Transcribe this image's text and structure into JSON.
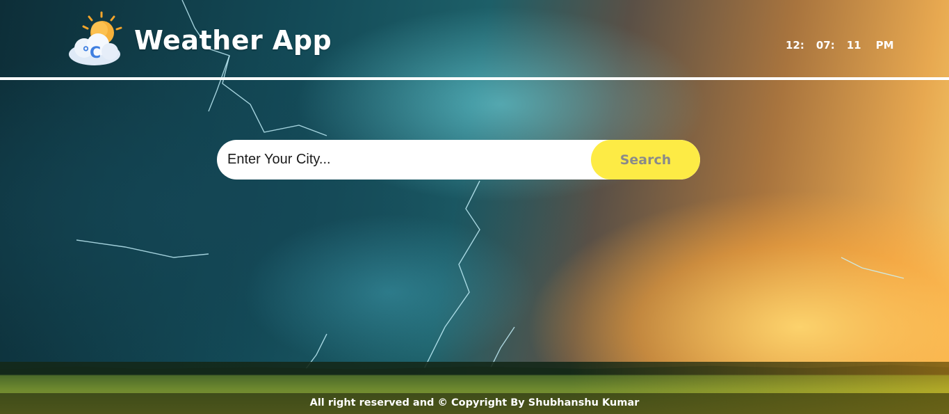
{
  "header": {
    "logo_icon": "sun-cloud-celsius-icon",
    "title": "Weather App"
  },
  "clock": {
    "hours": "12:",
    "minutes": "07:",
    "seconds": "11",
    "period": "PM"
  },
  "search": {
    "placeholder": "Enter Your City...",
    "value": "",
    "button_label": "Search"
  },
  "footer": {
    "text": "All right reserved and © Copyright By Shubhanshu Kumar"
  },
  "colors": {
    "accent": "#fdeb45",
    "search_text": "#8a8a8a",
    "header_rule": "#ffffff"
  }
}
